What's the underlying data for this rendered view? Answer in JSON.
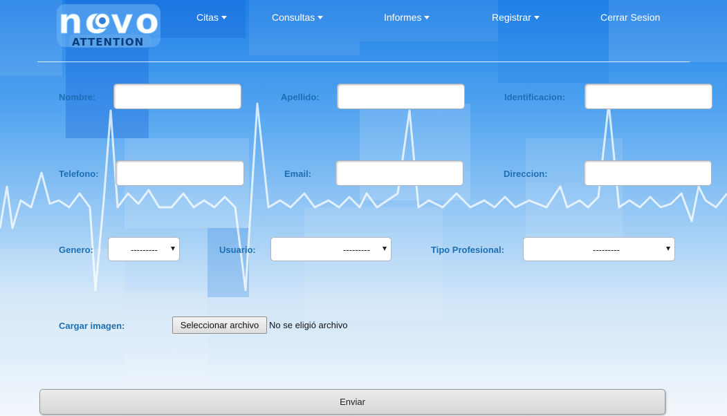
{
  "brand": {
    "logo_word": "novo",
    "logo_sub": "ATTENTION"
  },
  "nav": {
    "citas": "Citas",
    "consultas": "Consultas",
    "informes": "Informes",
    "registrar": "Registrar",
    "cerrar_sesion": "Cerrar Sesion"
  },
  "form": {
    "nombre": {
      "label": "Nombre:",
      "value": ""
    },
    "apellido": {
      "label": "Apellido:",
      "value": ""
    },
    "identificacion": {
      "label": "Identificacion:",
      "value": ""
    },
    "telefono": {
      "label": "Telefono:",
      "value": ""
    },
    "email": {
      "label": "Email:",
      "value": ""
    },
    "direccion": {
      "label": "Direccion:",
      "value": ""
    },
    "genero": {
      "label": "Genero:",
      "selected": "---------"
    },
    "usuario": {
      "label": "Usuario:",
      "selected": "---------"
    },
    "tipo_profesional": {
      "label": "Tipo Profesional:",
      "selected": "---------"
    },
    "imagen": {
      "label": "Cargar imagen:",
      "button": "Seleccionar archivo",
      "status": "No se eligió archivo"
    },
    "submit": "Enviar"
  },
  "colors": {
    "label": "#1c6fb3",
    "nav_text": "#ffffff",
    "bg_top": "#1e7fe6",
    "bg_bottom": "#f2f7fb"
  }
}
